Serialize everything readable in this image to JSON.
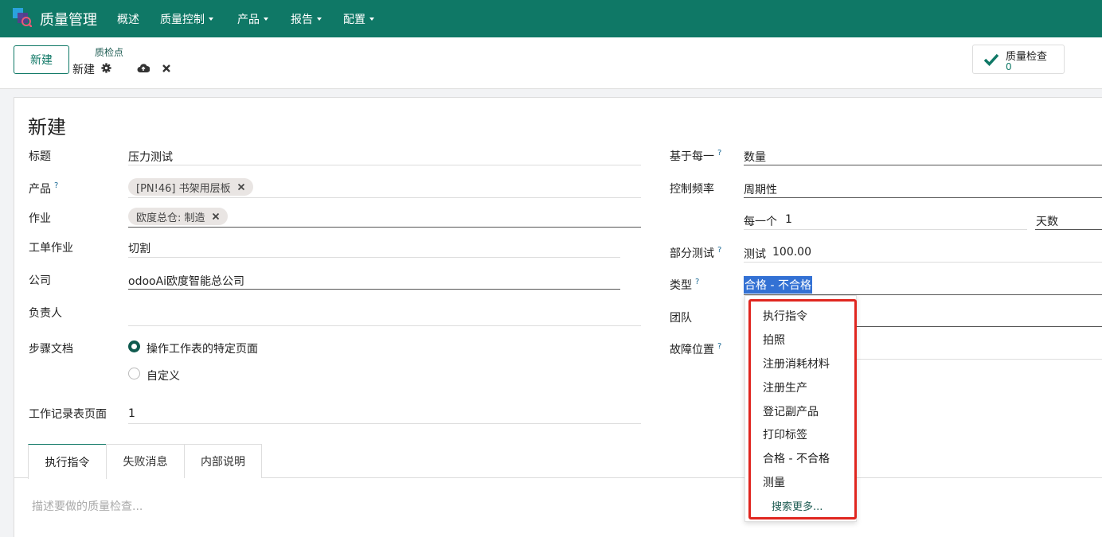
{
  "navbar": {
    "app_title": "质量管理",
    "menu": [
      "概述",
      "质量控制",
      "产品",
      "报告",
      "配置"
    ],
    "brand_color": "#0f7866"
  },
  "control": {
    "new_button": "新建",
    "breadcrumb_parent": "质检点",
    "breadcrumb_current": "新建",
    "smart_button_label": "质量检查",
    "smart_button_count": "0"
  },
  "form": {
    "record_title": "新建",
    "title_label": "标题",
    "title_value": "压力测试",
    "product_label": "产品",
    "product_tag": "[PN!46] 书架用层板",
    "operation_label": "作业",
    "operation_tag": "欧度总仓: 制造",
    "workorder_op_label": "工单作业",
    "workorder_op_value": "切割",
    "company_label": "公司",
    "company_value": "odooAi欧度智能总公司",
    "responsible_label": "负责人",
    "responsible_value": "",
    "step_doc_label": "步骤文档",
    "step_doc_option1": "操作工作表的特定页面",
    "step_doc_option2": "自定义",
    "worksheet_page_label": "工作记录表页面",
    "worksheet_page_value": "1",
    "based_on_label": "基于每一",
    "based_on_value": "数量",
    "control_freq_label": "控制频率",
    "control_freq_value": "周期性",
    "every_label": "每一个",
    "every_value": "1",
    "every_unit": "天数",
    "partial_test_label": "部分测试",
    "partial_test_prefix": "测试",
    "partial_test_value": "100.00",
    "type_label": "类型",
    "type_value": "合格 - 不合格",
    "team_label": "团队",
    "failure_location_label": "故障位置",
    "help_mark": "?"
  },
  "tabs": [
    "执行指令",
    "失败消息",
    "内部说明"
  ],
  "note_placeholder": "描述要做的质量检查...",
  "dropdown": {
    "items": [
      "执行指令",
      "拍照",
      "注册消耗材料",
      "注册生产",
      "登记副产品",
      "打印标签",
      "合格 - 不合格",
      "测量"
    ],
    "search_more": "搜索更多..."
  }
}
